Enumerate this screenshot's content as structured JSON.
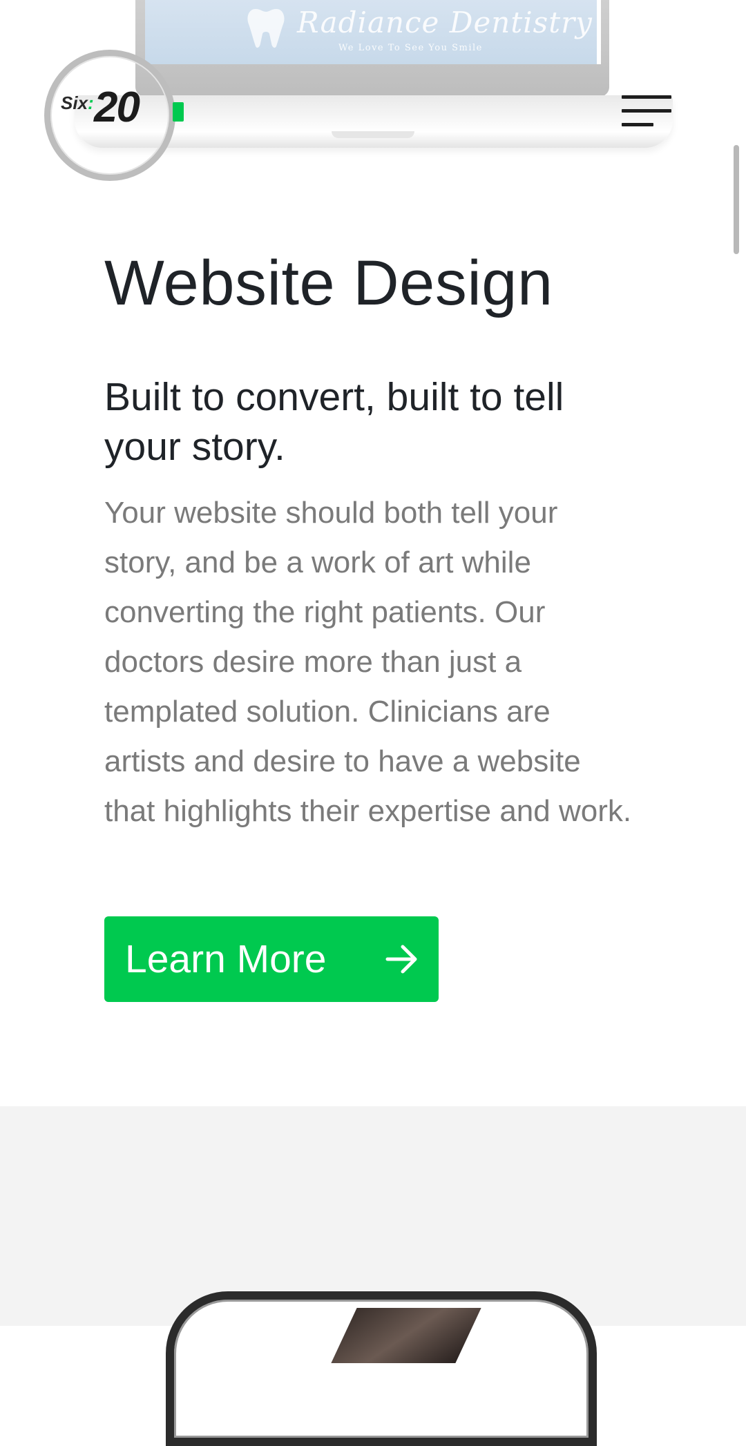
{
  "hero_mockup": {
    "screen_brand": "Radiance Dentistry",
    "screen_tagline": "We Love To See You Smile",
    "screen_bg": "#cfe0ee"
  },
  "header": {
    "logo": {
      "six": "Six",
      "colon": ":",
      "twenty": "20"
    },
    "menu_icon": "hamburger-menu-icon"
  },
  "main": {
    "title": "Website Design",
    "subtitle": "Built to convert, built to tell your story.",
    "body": "Your website should both tell your story, and be a work of art while converting the right patients. Our doctors desire more than just a templated solution. Clinicians are artists and desire to have a website that highlights their expertise and work.",
    "cta": {
      "label": "Learn More",
      "icon": "arrow-right-icon"
    }
  },
  "colors": {
    "accent_green": "#00c94f",
    "heading": "#1f2328",
    "body_text": "#7a7a7a",
    "section_grey": "#f3f3f3"
  }
}
